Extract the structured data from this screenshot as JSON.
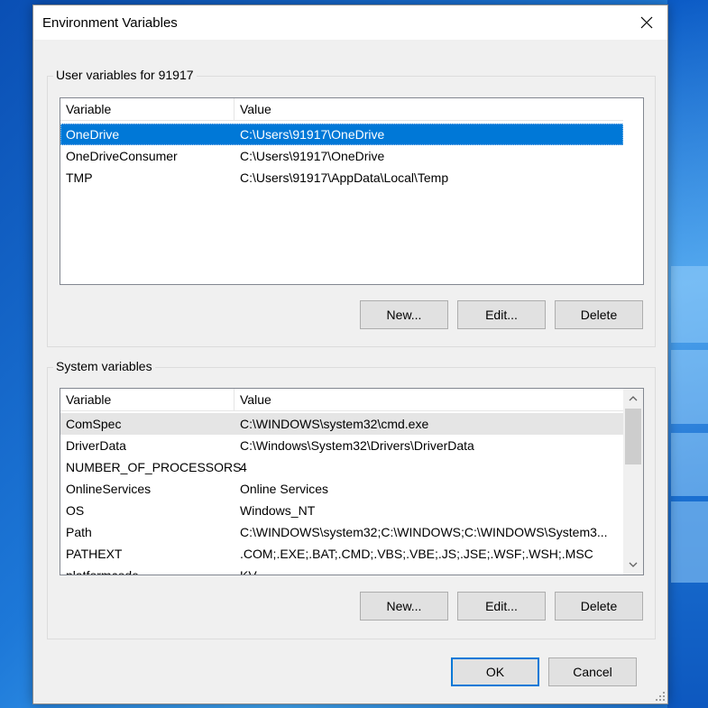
{
  "window": {
    "title": "Environment Variables"
  },
  "user_group": {
    "label": "User variables for 91917",
    "columns": [
      "Variable",
      "Value"
    ],
    "rows": [
      {
        "variable": "OneDrive",
        "value": "C:\\Users\\91917\\OneDrive",
        "selected": true
      },
      {
        "variable": "OneDriveConsumer",
        "value": "C:\\Users\\91917\\OneDrive"
      },
      {
        "variable": "TMP",
        "value": "C:\\Users\\91917\\AppData\\Local\\Temp"
      }
    ],
    "buttons": {
      "new": "New...",
      "edit": "Edit...",
      "delete": "Delete"
    }
  },
  "system_group": {
    "label": "System variables",
    "columns": [
      "Variable",
      "Value"
    ],
    "rows": [
      {
        "variable": "ComSpec",
        "value": "C:\\WINDOWS\\system32\\cmd.exe"
      },
      {
        "variable": "DriverData",
        "value": "C:\\Windows\\System32\\Drivers\\DriverData"
      },
      {
        "variable": "NUMBER_OF_PROCESSORS",
        "value": "4"
      },
      {
        "variable": "OnlineServices",
        "value": "Online Services"
      },
      {
        "variable": "OS",
        "value": "Windows_NT"
      },
      {
        "variable": "Path",
        "value": "C:\\WINDOWS\\system32;C:\\WINDOWS;C:\\WINDOWS\\System3..."
      },
      {
        "variable": "PATHEXT",
        "value": ".COM;.EXE;.BAT;.CMD;.VBS;.VBE;.JS;.JSE;.WSF;.WSH;.MSC"
      },
      {
        "variable": "platformcode",
        "value": "KV"
      }
    ],
    "buttons": {
      "new": "New...",
      "edit": "Edit...",
      "delete": "Delete"
    }
  },
  "footer": {
    "ok": "OK",
    "cancel": "Cancel"
  },
  "colors": {
    "selection": "#0078d7",
    "dialog_bg": "#f0f0f0",
    "desktop": "#1d78d8"
  }
}
